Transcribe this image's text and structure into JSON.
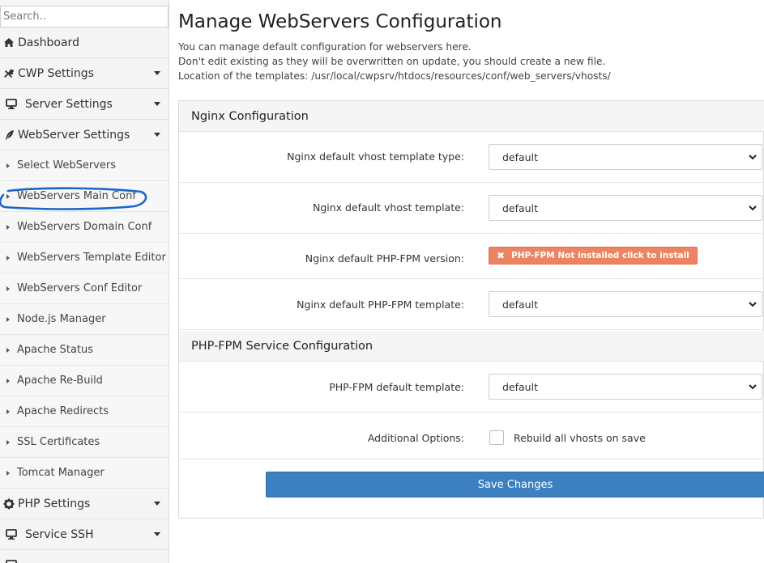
{
  "sidebar": {
    "search_placeholder": "Search..",
    "items": [
      {
        "label": "Dashboard",
        "icon": "home-icon"
      },
      {
        "label": "CWP Settings",
        "icon": "tools-icon"
      },
      {
        "label": "Server Settings",
        "icon": "monitor-icon"
      },
      {
        "label": "WebServer Settings",
        "icon": "feather-icon"
      }
    ],
    "subitems": [
      "Select WebServers",
      "WebServers Main Conf",
      "WebServers Domain Conf",
      "WebServers Template Editor",
      "WebServers Conf Editor",
      "Node.js Manager",
      "Apache Status",
      "Apache Re-Build",
      "Apache Redirects",
      "SSL Certificates",
      "Tomcat Manager"
    ],
    "bottom_items": [
      {
        "label": "PHP Settings",
        "icon": "gear-icon"
      },
      {
        "label": "Service SSH",
        "icon": "monitor-icon"
      }
    ],
    "highlight_color": "#1a66c8"
  },
  "main": {
    "title": "Manage WebServers Configuration",
    "description": [
      "You can manage default configuration for webservers here.",
      "Don't edit existing as they will be overwritten on update, you should create a new file.",
      "Location of the templates: /usr/local/cwpsrv/htdocs/resources/conf/web_servers/vhosts/"
    ],
    "nginx": {
      "heading": "Nginx Configuration",
      "rows": [
        {
          "label": "Nginx default vhost template type:",
          "value": "default"
        },
        {
          "label": "Nginx default vhost template:",
          "value": "default"
        },
        {
          "label": "Nginx default PHP-FPM version:",
          "button": "PHP-FPM Not installed click to install"
        },
        {
          "label": "Nginx default PHP-FPM template:",
          "value": "default"
        }
      ]
    },
    "phpfpm": {
      "heading": "PHP-FPM Service Configuration",
      "rows": [
        {
          "label": "PHP-FPM default template:",
          "value": "default"
        },
        {
          "label": "Additional Options:",
          "checkbox_label": "Rebuild all vhosts on save"
        }
      ]
    },
    "save_label": "Save Changes"
  },
  "colors": {
    "accent": "#3d80c2",
    "warning": "#ec8462"
  }
}
